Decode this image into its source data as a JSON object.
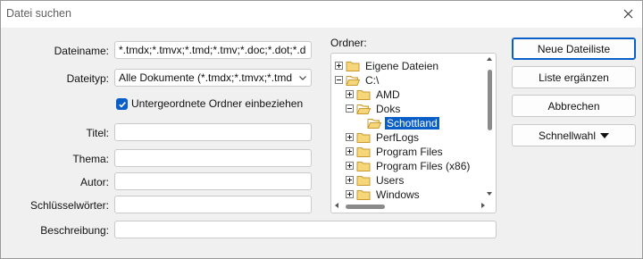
{
  "window": {
    "title": "Datei suchen"
  },
  "form": {
    "filename_label": "Dateiname:",
    "filename_value": "*.tmdx;*.tmvx;*.tmd;*.tmv;*.doc;*.dot;*.d",
    "filetype_label": "Dateityp:",
    "filetype_value": "Alle Dokumente (*.tmdx;*.tmvx;*.tmd",
    "include_subfolders_label": "Untergeordnete Ordner einbeziehen",
    "include_subfolders_checked": true,
    "title_label": "Titel:",
    "title_value": "",
    "subject_label": "Thema:",
    "subject_value": "",
    "author_label": "Autor:",
    "author_value": "",
    "keywords_label": "Schlüsselwörter:",
    "keywords_value": "",
    "description_label": "Beschreibung:",
    "description_value": ""
  },
  "folder": {
    "label": "Ordner:",
    "tree": [
      {
        "label": "Eigene Dateien",
        "level": 0,
        "expander": "plus",
        "open": false,
        "selected": false
      },
      {
        "label": "C:\\",
        "level": 0,
        "expander": "minus",
        "open": true,
        "selected": false
      },
      {
        "label": "AMD",
        "level": 1,
        "expander": "plus",
        "open": false,
        "selected": false
      },
      {
        "label": "Doks",
        "level": 1,
        "expander": "minus",
        "open": true,
        "selected": false
      },
      {
        "label": "Schottland",
        "level": 2,
        "expander": "none",
        "open": true,
        "selected": true
      },
      {
        "label": "PerfLogs",
        "level": 1,
        "expander": "plus",
        "open": false,
        "selected": false
      },
      {
        "label": "Program Files",
        "level": 1,
        "expander": "plus",
        "open": false,
        "selected": false
      },
      {
        "label": "Program Files (x86)",
        "level": 1,
        "expander": "plus",
        "open": false,
        "selected": false
      },
      {
        "label": "Users",
        "level": 1,
        "expander": "plus",
        "open": false,
        "selected": false
      },
      {
        "label": "Windows",
        "level": 1,
        "expander": "plus",
        "open": false,
        "selected": false
      }
    ]
  },
  "buttons": {
    "new_list": "Neue Dateiliste",
    "append_list": "Liste ergänzen",
    "cancel": "Abbrechen",
    "quick_select": "Schnellwahl"
  },
  "icons": {
    "close": "close-icon",
    "dropdown": "chevron-down-icon",
    "check": "checkmark-icon",
    "folder": "folder-icon",
    "open_folder": "folder-open-icon",
    "caret": "caret-down-icon"
  },
  "colors": {
    "accent": "#0a5ec8",
    "dialog_bg": "#f0f0f0",
    "folder_fill": "#f6d67a",
    "folder_stroke": "#c99a2e"
  }
}
